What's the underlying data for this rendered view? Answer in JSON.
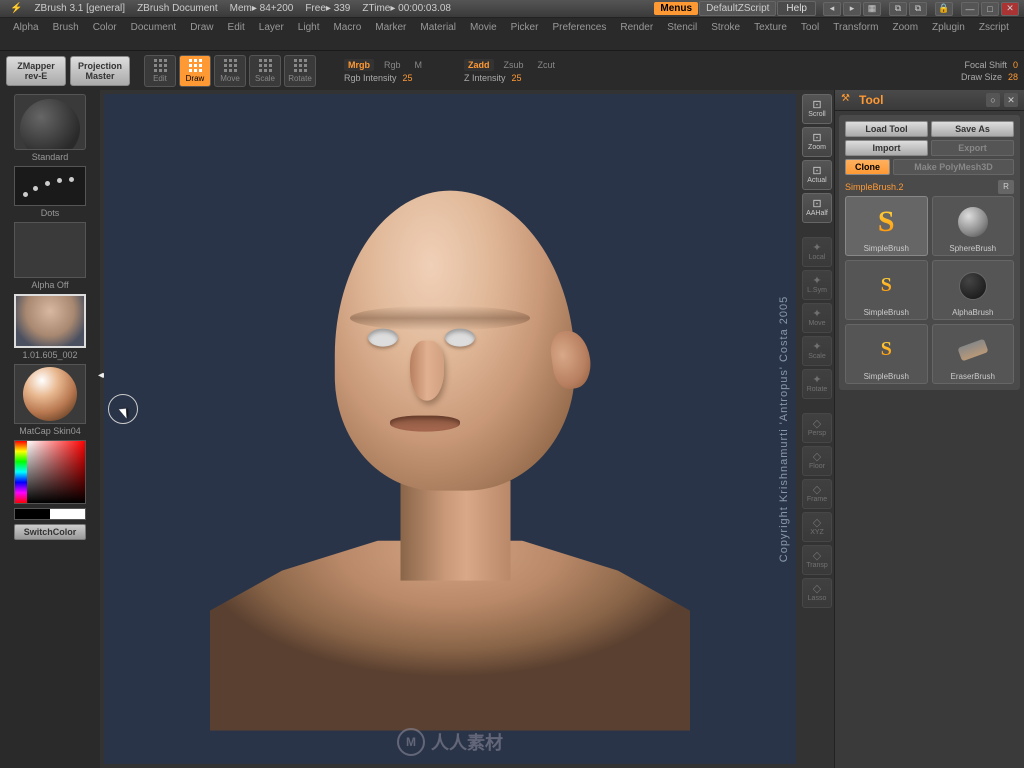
{
  "titlebar": {
    "app": "ZBrush 3.1 [general]",
    "doc": "ZBrush Document",
    "mem": "Mem▸ 84+200",
    "free": "Free▸ 339",
    "ztime": "ZTime▸ 00:00:03.08",
    "menus": "Menus",
    "zscript": "DefaultZScript",
    "help": "Help"
  },
  "menubar": [
    "Alpha",
    "Brush",
    "Color",
    "Document",
    "Draw",
    "Edit",
    "Layer",
    "Light",
    "Macro",
    "Marker",
    "Material",
    "Movie",
    "Picker",
    "Preferences",
    "Render",
    "Stencil",
    "Stroke",
    "Texture",
    "Tool",
    "Transform",
    "Zoom",
    "Zplugin",
    "Zscript"
  ],
  "toolbar": {
    "zmapper": {
      "line1": "ZMapper",
      "line2": "rev-E"
    },
    "projection": {
      "line1": "Projection",
      "line2": "Master"
    },
    "icons": [
      "Edit",
      "Draw",
      "Move",
      "Scale",
      "Rotate"
    ],
    "active_icon": "Draw",
    "rgb_mode": {
      "active": "Mrgb",
      "options": [
        "Mrgb",
        "Rgb",
        "M"
      ]
    },
    "rgb_intensity": {
      "label": "Rgb Intensity",
      "value": "25"
    },
    "z_mode": {
      "active": "Zadd",
      "options": [
        "Zadd",
        "Zsub",
        "Zcut"
      ]
    },
    "z_intensity": {
      "label": "Z Intensity",
      "value": "25"
    },
    "focal_shift": {
      "label": "Focal Shift",
      "value": "0"
    },
    "draw_size": {
      "label": "Draw Size",
      "value": "28"
    }
  },
  "left_panel": {
    "brush": "Standard",
    "stroke": "Dots",
    "alpha": "Alpha Off",
    "texture": "1.01.605_002",
    "material": "MatCap Skin04",
    "switch": "SwitchColor"
  },
  "right_tools": {
    "nav": [
      "Scroll",
      "Zoom",
      "Actual",
      "AAHalf"
    ],
    "extras": [
      "Local",
      "L.Sym",
      "Move",
      "Scale",
      "Rotate"
    ],
    "bottom": [
      "Persp",
      "Floor",
      "Frame",
      "XYZ",
      "Transp",
      "Lasso"
    ]
  },
  "tool_panel": {
    "title": "Tool",
    "buttons": {
      "load": "Load Tool",
      "save": "Save As",
      "import": "Import",
      "export": "Export",
      "clone": "Clone",
      "polymesh": "Make PolyMesh3D"
    },
    "current_tool": "SimpleBrush.",
    "current_n": "2",
    "r": "R",
    "tools": [
      {
        "name": "SimpleBrush",
        "icon": "s"
      },
      {
        "name": "SphereBrush",
        "icon": "sphere"
      },
      {
        "name": "SimpleBrush",
        "icon": "s-small"
      },
      {
        "name": "AlphaBrush",
        "icon": "alpha"
      },
      {
        "name": "SimpleBrush",
        "icon": "s-small"
      },
      {
        "name": "EraserBrush",
        "icon": "eraser"
      }
    ]
  },
  "canvas": {
    "copyright": "Copyright Krishnamurti 'Antropus' Costa 2005",
    "watermark": "人人素材"
  }
}
